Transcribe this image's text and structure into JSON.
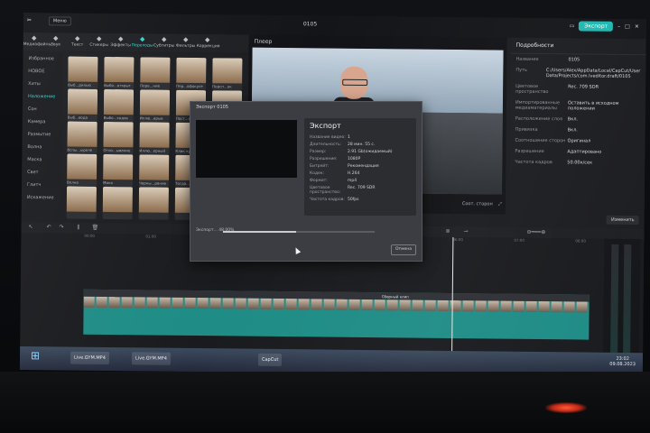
{
  "app": {
    "title": "0105",
    "menu_label": "Меню",
    "export_label": "Экспорт"
  },
  "toolbar": {
    "items": [
      {
        "label": "Медиафайлы",
        "icon": "media-icon",
        "active": false
      },
      {
        "label": "Звук",
        "icon": "audio-icon",
        "active": false
      },
      {
        "label": "Текст",
        "icon": "text-icon",
        "active": false
      },
      {
        "label": "Стикеры",
        "icon": "sticker-icon",
        "active": false
      },
      {
        "label": "Эффекты",
        "icon": "effects-icon",
        "active": false
      },
      {
        "label": "Переходы",
        "icon": "transition-icon",
        "active": true
      },
      {
        "label": "Субтитры",
        "icon": "subtitle-icon",
        "active": false
      },
      {
        "label": "Фильтры",
        "icon": "filter-icon",
        "active": false
      },
      {
        "label": "Коррекция",
        "icon": "adjust-icon",
        "active": false
      }
    ]
  },
  "left_nav": {
    "items": [
      {
        "label": "Избранное",
        "active": false
      },
      {
        "label": "НОВОЕ",
        "active": false
      },
      {
        "label": "Хиты",
        "active": false
      },
      {
        "label": "Наложение",
        "active": true
      },
      {
        "label": "Сон",
        "active": false
      },
      {
        "label": "Камера",
        "active": false
      },
      {
        "label": "Размытие",
        "active": false
      },
      {
        "label": "Волна",
        "active": false
      },
      {
        "label": "Маска",
        "active": false
      },
      {
        "label": "Свет",
        "active": false
      },
      {
        "label": "Глитч",
        "active": false
      },
      {
        "label": "Искажение",
        "active": false
      }
    ]
  },
  "media": {
    "thumbs": [
      "Выб...рилью",
      "Выбо...открыт",
      "Пере...ние",
      "Пер...офокусе",
      "Персп...ок",
      "Выб...вода",
      "Выбо...ходов",
      "Иллю...врыв",
      "Пост...ставка",
      "Пере...ффект",
      "Вспы...ыреле",
      "Отло...ывание",
      "Иллю...ерный",
      "Клик курсора",
      "Пере...ходов",
      "Волна",
      "Мико",
      "Черны...ранив",
      "Тогда...ачно",
      "Блик",
      "",
      "",
      "",
      "",
      ""
    ]
  },
  "player": {
    "header": "Плеер",
    "ratio_label": "Соот. сторон"
  },
  "details": {
    "header": "Подробности",
    "rows": [
      {
        "k": "Название",
        "v": "0105"
      },
      {
        "k": "Путь",
        "v": "C:/Users/Alex/AppData/Local/CapCut/User Data/Projects/com.lveditor.draft/0105"
      },
      {
        "k": "Цветовое пространство",
        "v": "Rec. 709 SDR"
      },
      {
        "k": "Импортированные медиаматериалы",
        "v": "Оставить в исходном положении"
      },
      {
        "k": "Расположение слоя",
        "v": "Вкл."
      },
      {
        "k": "Привязка",
        "v": "Вкл."
      },
      {
        "k": "Соотношение сторон",
        "v": "Оригинал"
      },
      {
        "k": "Разрешение",
        "v": "Адаптировано"
      },
      {
        "k": "Частота кадров",
        "v": "50.00к/сек"
      }
    ],
    "change_label": "Изменить"
  },
  "timeline": {
    "ruler_ticks": [
      "00:00",
      "01:00",
      "02:00",
      "03:00",
      "04:00",
      "05:00",
      "06:00",
      "07:00",
      "08:00"
    ],
    "clip_label": "Сборный клип"
  },
  "dialog": {
    "title": "Экспорт 0105",
    "heading": "Экспорт",
    "rows": [
      {
        "k": "Название видео:",
        "v": "1"
      },
      {
        "k": "Длительность:",
        "v": "28 мин. 55 с."
      },
      {
        "k": "Размер:",
        "v": "2.91 Gb(ожидаемый)"
      },
      {
        "k": "Разрешение:",
        "v": "1080P"
      },
      {
        "k": "Битрейт:",
        "v": "Рекомендация"
      },
      {
        "k": "Кодек:",
        "v": "H.264"
      },
      {
        "k": "Формат:",
        "v": "mp4"
      },
      {
        "k": "Цветовое пространство:",
        "v": "Rec. 709 SDR"
      },
      {
        "k": "Частота кадров:",
        "v": "50fps"
      }
    ],
    "progress_text": "Экспорт... 48.00%",
    "progress": 0.48,
    "cancel_label": "Отмена"
  },
  "taskbar": {
    "items": [
      {
        "label": "Live.GYM.MP4"
      },
      {
        "label": "Live.GYM.MP4"
      },
      {
        "label": "CapCut"
      }
    ],
    "time": "23:02",
    "date": "09.08.2023"
  }
}
